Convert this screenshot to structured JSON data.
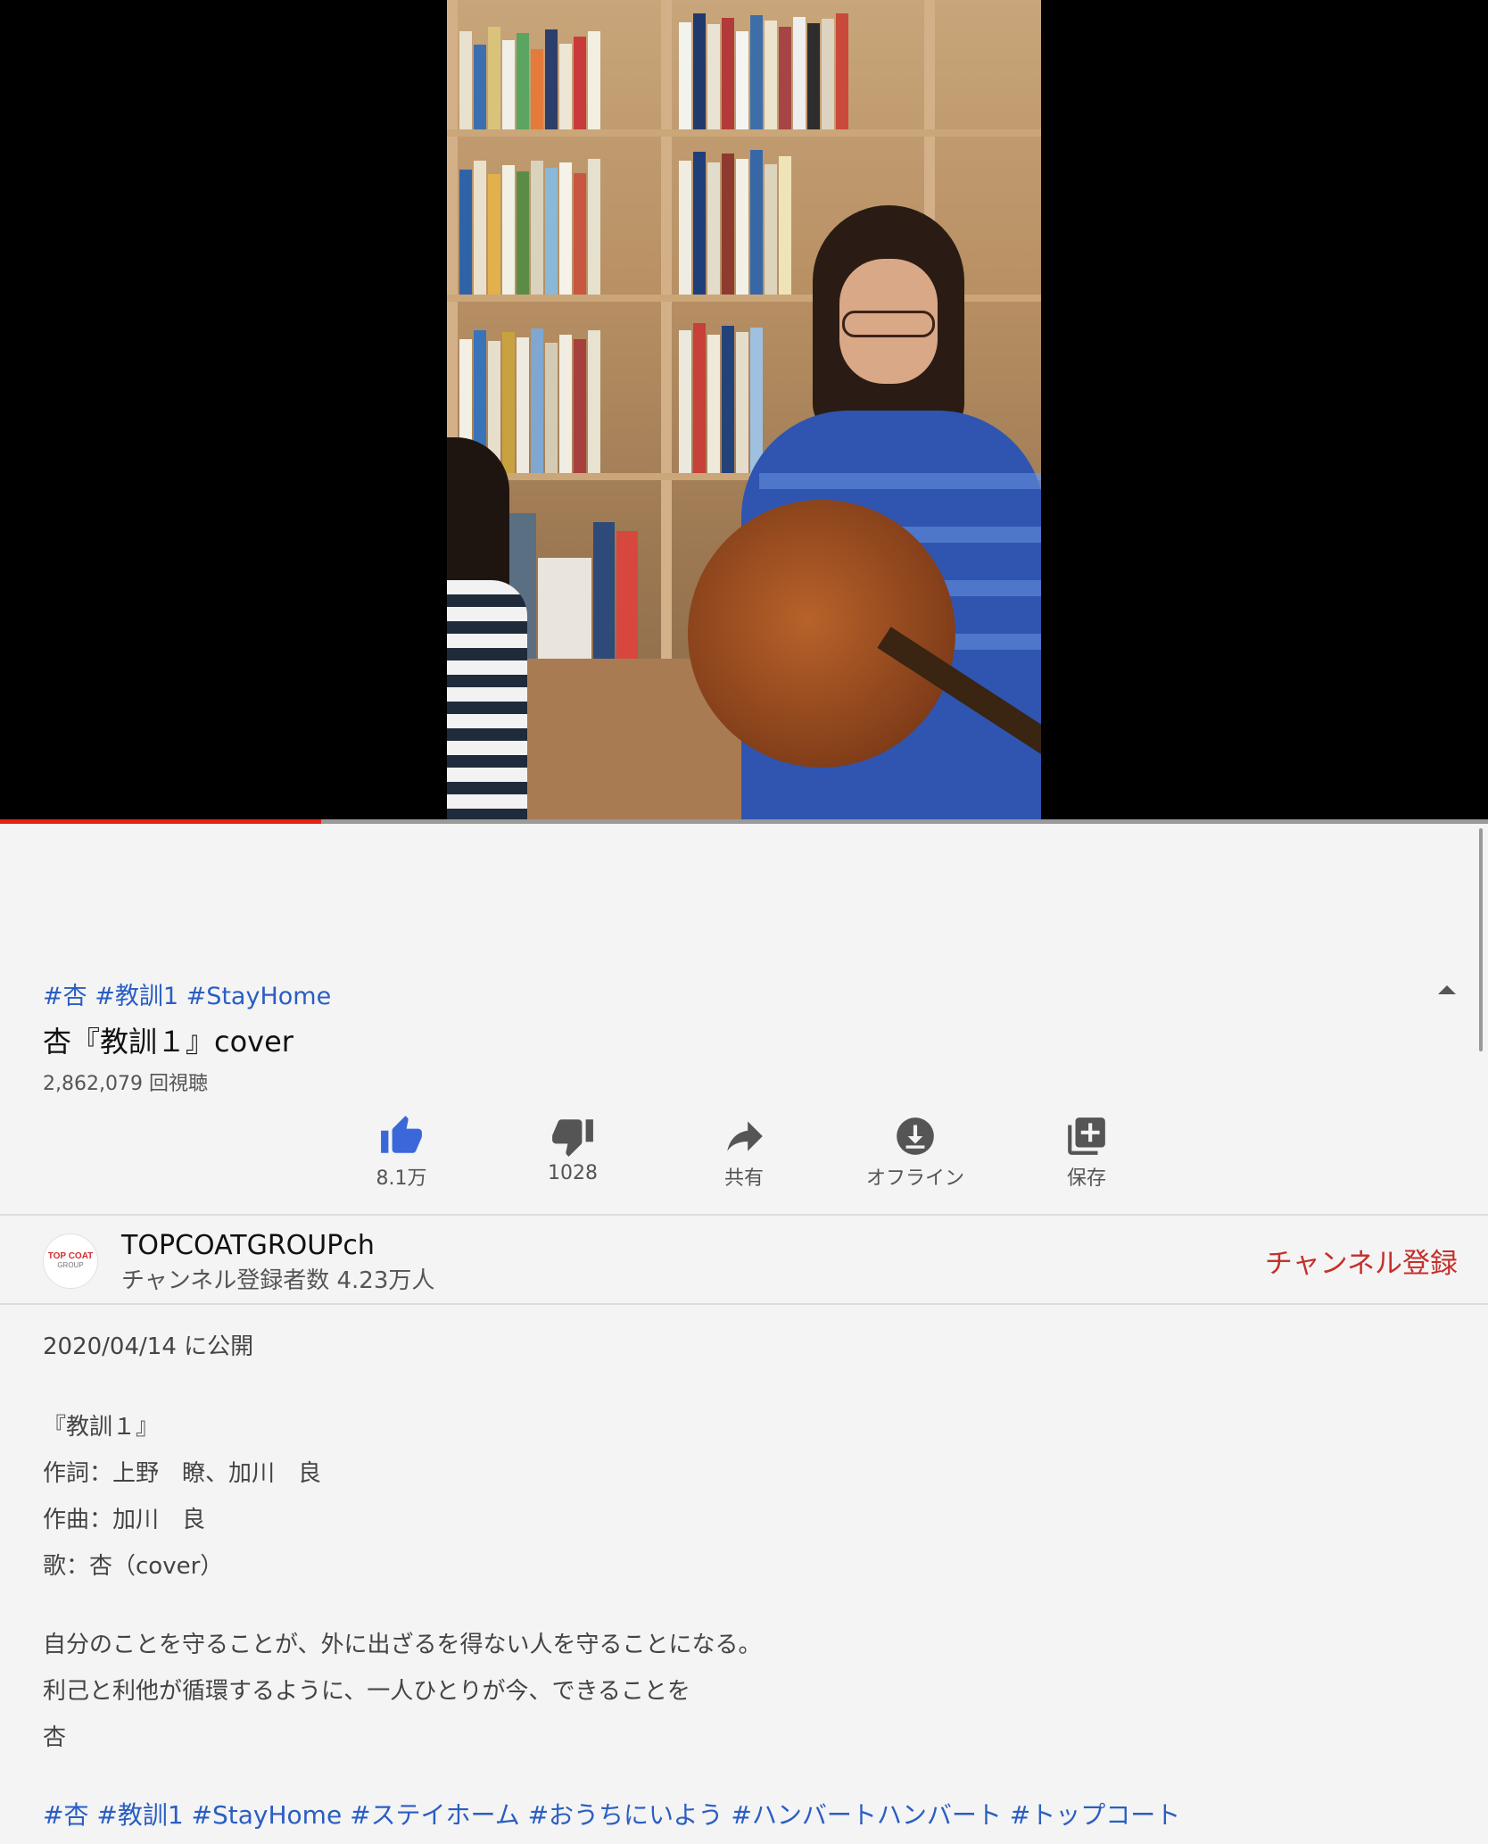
{
  "player": {
    "progress_fraction": 0.216
  },
  "video": {
    "hashtags": "#杏 #教訓1 #StayHome",
    "title": "杏『教訓１』cover",
    "views": "2,862,079 回視聴"
  },
  "actions": [
    {
      "icon": "thumbs-up-icon",
      "label": "8.1万"
    },
    {
      "icon": "thumbs-down-icon",
      "label": "1028"
    },
    {
      "icon": "share-icon",
      "label": "共有"
    },
    {
      "icon": "download-icon",
      "label": "オフライン"
    },
    {
      "icon": "add-to-playlist-icon",
      "label": "保存"
    }
  ],
  "channel": {
    "avatar_line1": "TOP COAT",
    "avatar_line2": "GROUP",
    "name": "TOPCOATGROUPch",
    "subscribers": "チャンネル登録者数 4.23万人",
    "subscribe_label": "チャンネル登録"
  },
  "description": {
    "published": "2020/04/14 に公開",
    "lines": [
      "『教訓１』",
      "作詞：上野　瞭、加川　良",
      "作曲：加川　良",
      "歌：杏（cover）",
      "自分のことを守ることが、外に出ざるを得ない人を守ることになる。",
      "利己と利他が循環するように、一人ひとりが今、できることを",
      "杏"
    ],
    "hashtags": "#杏 #教訓1 #StayHome #ステイホーム #おうちにいよう #ハンバートハンバート #トップコート"
  },
  "colors": {
    "accent": "#2a5ec3",
    "like_active": "#3a67d9",
    "subscribe": "#c4302b",
    "progress": "#e62117"
  }
}
